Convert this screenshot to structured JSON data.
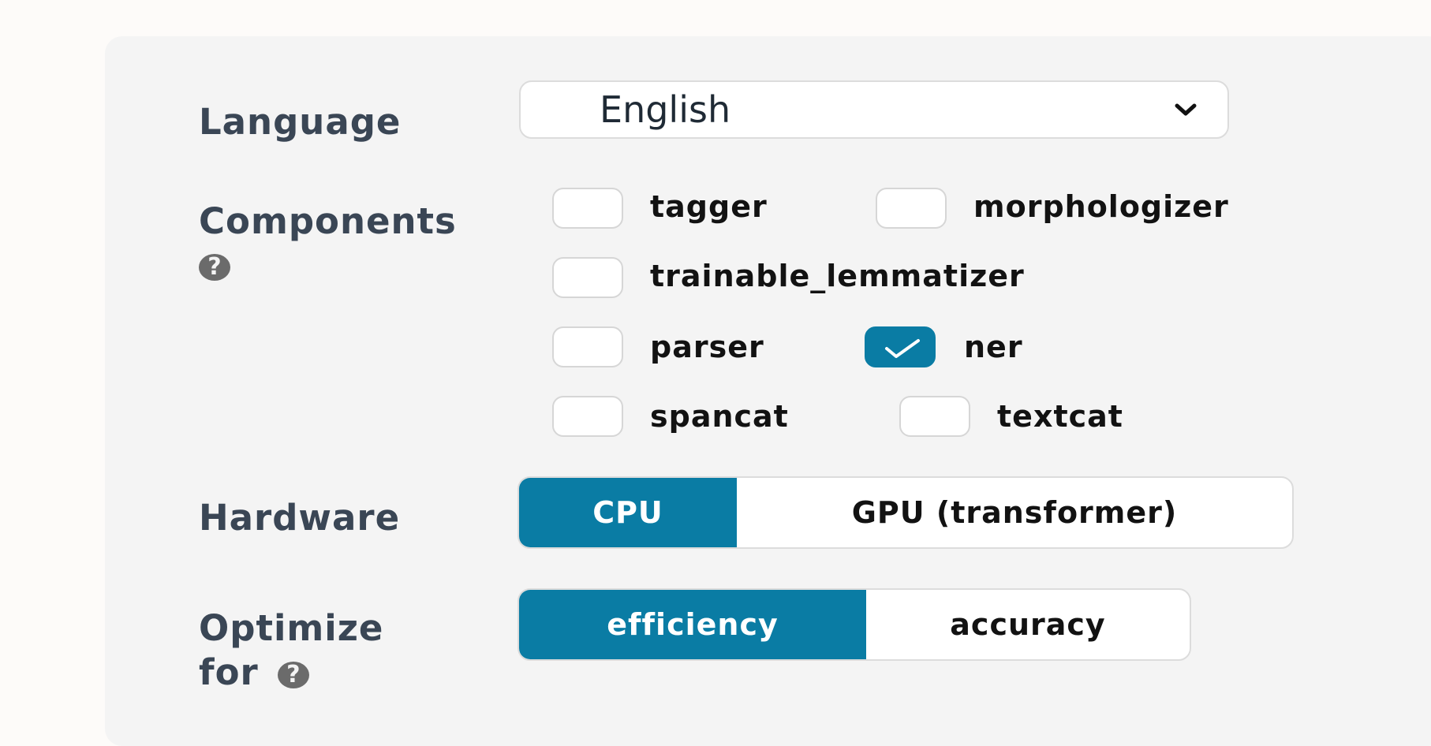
{
  "language": {
    "label": "Language",
    "selected": "English"
  },
  "components": {
    "label": "Components",
    "help_glyph": "?",
    "items": [
      {
        "name": "tagger",
        "checked": false
      },
      {
        "name": "morphologizer",
        "checked": false
      },
      {
        "name": "trainable_lemmatizer",
        "checked": false
      },
      {
        "name": "parser",
        "checked": false
      },
      {
        "name": "ner",
        "checked": true
      },
      {
        "name": "spancat",
        "checked": false
      },
      {
        "name": "textcat",
        "checked": false
      }
    ]
  },
  "hardware": {
    "label": "Hardware",
    "options": [
      "CPU",
      "GPU (transformer)"
    ],
    "selected": "CPU"
  },
  "optimize": {
    "label_line1": "Optimize",
    "label_line2": "for",
    "help_glyph": "?",
    "options": [
      "efficiency",
      "accuracy"
    ],
    "selected": "efficiency"
  },
  "colors": {
    "accent": "#0a7ca4",
    "panel_bg": "#f4f4f4",
    "label_text": "#3a4655"
  },
  "icons": {
    "help": "question-circle-icon",
    "dropdown": "chevron-down-icon",
    "check": "checkmark-icon"
  }
}
